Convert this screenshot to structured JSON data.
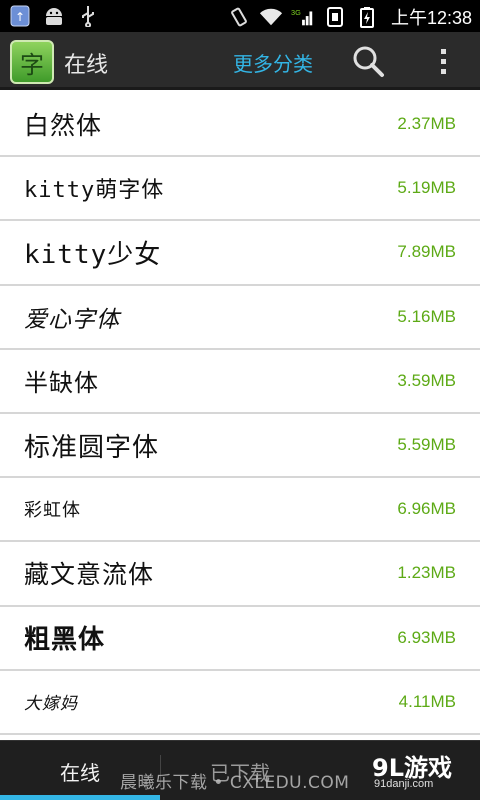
{
  "status_bar": {
    "time": "上午12:38",
    "network_label": "3G"
  },
  "action_bar": {
    "title": "在线",
    "more_categories": "更多分类",
    "search_icon": "search-icon",
    "menu_icon": "overflow-menu-icon"
  },
  "fonts": [
    {
      "name": "白然体",
      "size": "2.37MB"
    },
    {
      "name": "kitty萌字体",
      "size": "5.19MB"
    },
    {
      "name": "kitty少女",
      "size": "7.89MB"
    },
    {
      "name": "爱心字体",
      "size": "5.16MB"
    },
    {
      "name": "半缺体",
      "size": "3.59MB"
    },
    {
      "name": "标准圆字体",
      "size": "5.59MB"
    },
    {
      "name": "彩虹体",
      "size": "6.96MB"
    },
    {
      "name": "藏文意流体",
      "size": "1.23MB"
    },
    {
      "name": "粗黑体",
      "size": "6.93MB"
    },
    {
      "name": "大嫁妈",
      "size": "4.11MB"
    }
  ],
  "tabs": {
    "online": "在线",
    "downloaded": "已下载"
  },
  "watermark": "晨曦乐下载 • CXLEDU.COM",
  "brand": {
    "name": "9L游戏",
    "url": "91danji.com"
  },
  "colors": {
    "accent": "#33b5e5",
    "size_text": "#5daa16",
    "action_bar": "#2b2b2b"
  }
}
